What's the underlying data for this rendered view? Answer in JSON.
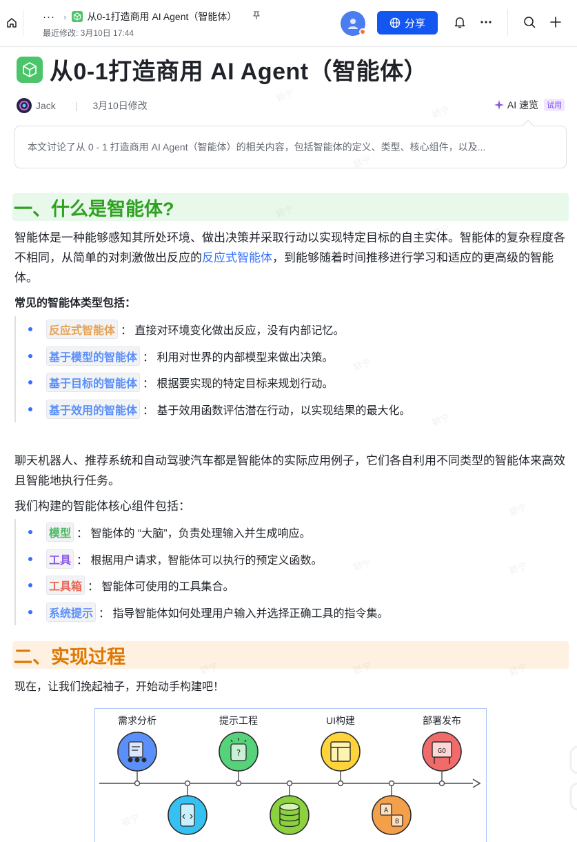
{
  "topbar": {
    "more": "···",
    "doc_title": "从0-1打造商用 AI Agent（智能体）",
    "last_modified": "最近修改: 3月10日 17:44",
    "share_label": "分享"
  },
  "doc": {
    "title": "从0-1打造商用 AI Agent（智能体）",
    "author": "Jack",
    "modified": "3月10日修改",
    "ai_label": "AI 速览",
    "trial": "试用",
    "summary": "本文讨论了从 0 - 1 打造商用 AI Agent（智能体）的相关内容，包括智能体的定义、类型、核心组件，以及..."
  },
  "section1": {
    "heading": "一、什么是智能体?",
    "intro_pre": "智能体是一种能够感知其所处环境、做出决策并采取行动以实现特定目标的自主实体。智能体的复杂程度各不相同，从简单的对刺激做出反应的",
    "intro_link": "反应式智能体",
    "intro_post": "，到能够随着时间推移进行学习和适应的更高级的智能体。",
    "types_heading": "常见的智能体类型包括：",
    "types": [
      {
        "term": "反应式智能体",
        "desc": "： 直接对环境变化做出反应，没有内部记忆。"
      },
      {
        "term": "基于模型的智能体",
        "desc": "： 利用对世界的内部模型来做出决策。"
      },
      {
        "term": "基于目标的智能体",
        "desc": "： 根据要实现的特定目标来规划行动。"
      },
      {
        "term": "基于效用的智能体",
        "desc": "： 基于效用函数评估潜在行动，以实现结果的最大化。"
      }
    ],
    "examples": "聊天机器人、推荐系统和自动驾驶汽车都是智能体的实际应用例子，它们各自利用不同类型的智能体来高效且智能地执行任务。",
    "components_heading": "我们构建的智能体核心组件包括：",
    "components": [
      {
        "term": "模型",
        "desc": "： 智能体的 “大脑”，负责处理输入并生成响应。"
      },
      {
        "term": "工具",
        "desc": "： 根据用户请求，智能体可以执行的预定义函数。"
      },
      {
        "term": "工具箱",
        "desc": "： 智能体可使用的工具集合。"
      },
      {
        "term": "系统提示",
        "desc": "： 指导智能体如何处理用户输入并选择正确工具的指令集。"
      }
    ]
  },
  "section2": {
    "heading": "二、实现过程",
    "intro": "现在，让我们挽起袖子，开始动手构建吧！",
    "diagram_labels": [
      "需求分析",
      "提示工程",
      "UI构建",
      "部署发布"
    ]
  },
  "watermark": "颖宁",
  "colors": {
    "accent": "#3370ff",
    "share": "#1456f0",
    "h1_green": "#2ea121",
    "h1_orange": "#de7802"
  }
}
